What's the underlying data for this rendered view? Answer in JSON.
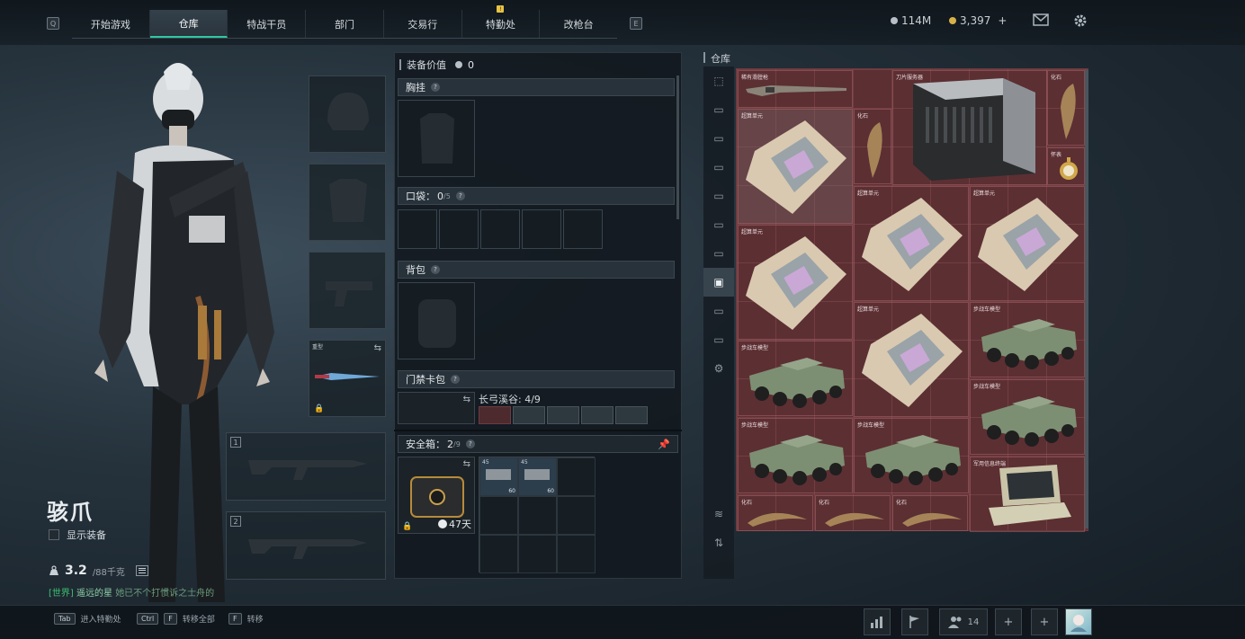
{
  "topbar": {
    "left_key": "Q",
    "right_key": "E",
    "tabs": [
      {
        "label": "开始游戏",
        "active": false
      },
      {
        "label": "仓库",
        "active": true
      },
      {
        "label": "特战干员",
        "active": false
      },
      {
        "label": "部门",
        "active": false
      },
      {
        "label": "交易行",
        "active": false
      },
      {
        "label": "特勤处",
        "active": false
      },
      {
        "label": "改枪台",
        "active": false
      }
    ],
    "notification_badge": "!",
    "currency_a": "114M",
    "currency_b": "3,397",
    "currency_b_add": "+",
    "accent": "#2fc7a2"
  },
  "character": {
    "name": "骇爪",
    "show_equipment_label": "显示装备",
    "capacity_value": "3.2",
    "capacity_max": "/88千克",
    "chat_channel": "[世界]",
    "chat_user": "遥远的星",
    "chat_text": "她已不个打惯诉之士舟的"
  },
  "equipment": {
    "melee_slot_label": "重型",
    "weapon1_index": "1",
    "weapon2_index": "2"
  },
  "middle": {
    "value_label": "装备价值",
    "value": "0",
    "chest_label": "胸挂",
    "pocket_label": "口袋：",
    "pocket_count": "0",
    "pocket_max": "/5",
    "backpack_label": "背包",
    "keycard_label": "门禁卡包",
    "keycard_map": "长弓溪谷: 4/9",
    "safebox_label": "安全箱：",
    "safebox_count": "2",
    "safebox_max": "/9",
    "safebox_days": "47天",
    "safe_item_top": "45",
    "safe_item_bottom": "60"
  },
  "storage": {
    "title": "仓库",
    "items": [
      {
        "label": "稀有滑膛枪"
      },
      {
        "label": "刀片服务器"
      },
      {
        "label": "化石"
      },
      {
        "label": "超算单元"
      },
      {
        "label": "化石"
      },
      {
        "label": "怀表"
      },
      {
        "label": "超算单元"
      },
      {
        "label": "超算单元"
      },
      {
        "label": "超算单元"
      },
      {
        "label": "超算单元"
      },
      {
        "label": "步战车模型"
      },
      {
        "label": "步战车模型"
      },
      {
        "label": "步战车模型"
      },
      {
        "label": "步战车模型"
      },
      {
        "label": "步战车模型"
      },
      {
        "label": "军用信息终端"
      },
      {
        "label": "化石"
      },
      {
        "label": "化石"
      },
      {
        "label": "化石"
      }
    ]
  },
  "bottombar": {
    "hint1_key": "Tab",
    "hint1_text": "进入特勤处",
    "hint2_key1": "Ctrl",
    "hint2_key2": "F",
    "hint2_text": "转移全部",
    "hint3_key": "F",
    "hint3_text": "转移",
    "friends_count": "14"
  }
}
